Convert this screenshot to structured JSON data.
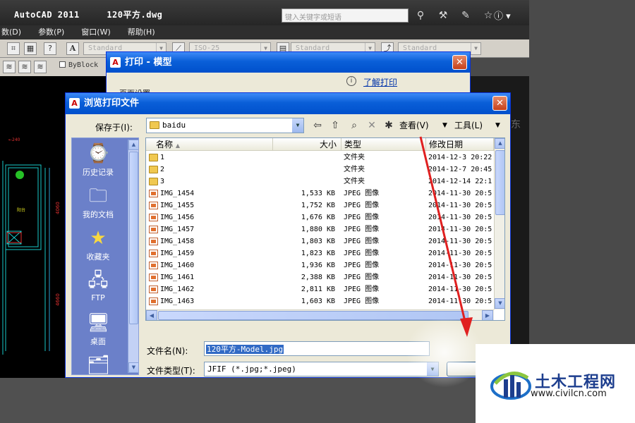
{
  "window": {
    "title": "AutoCAD 2011     120平方.dwg",
    "search_placeholder": "键入关键字或短语"
  },
  "menubar": {
    "items": [
      "数(D)",
      "参数(P)",
      "窗口(W)",
      "帮助(H)"
    ]
  },
  "toolbar": {
    "text_style": "Standard",
    "dim_style": "ISO-25",
    "table_style": "Standard",
    "mleader_style": "Standard",
    "linetype": "ByBlock"
  },
  "print_dialog": {
    "title": "打印 - 模型",
    "help_link": "了解打印",
    "page_setup_label": "页面设置"
  },
  "browse_dialog": {
    "title": "浏览打印文件",
    "save_in_label": "保存于(I):",
    "save_in_value": "baidu",
    "view_label": "查看(V)",
    "tools_label": "工具(L)",
    "places": [
      "历史记录",
      "我的文档",
      "收藏夹",
      "FTP",
      "桌面"
    ],
    "columns": {
      "name": "名称",
      "size": "大小",
      "type": "类型",
      "modified": "修改日期"
    },
    "files": [
      {
        "name": "1",
        "size": "",
        "type": "文件夹",
        "modified": "2014-12-3 20:22",
        "kind": "folder"
      },
      {
        "name": "2",
        "size": "",
        "type": "文件夹",
        "modified": "2014-12-7 20:45",
        "kind": "folder"
      },
      {
        "name": "3",
        "size": "",
        "type": "文件夹",
        "modified": "2014-12-14 22:1",
        "kind": "folder"
      },
      {
        "name": "IMG_1454",
        "size": "1,533 KB",
        "type": "JPEG 图像",
        "modified": "2014-11-30 20:5",
        "kind": "jpg"
      },
      {
        "name": "IMG_1455",
        "size": "1,752 KB",
        "type": "JPEG 图像",
        "modified": "2014-11-30 20:5",
        "kind": "jpg"
      },
      {
        "name": "IMG_1456",
        "size": "1,676 KB",
        "type": "JPEG 图像",
        "modified": "2014-11-30 20:5",
        "kind": "jpg"
      },
      {
        "name": "IMG_1457",
        "size": "1,880 KB",
        "type": "JPEG 图像",
        "modified": "2014-11-30 20:5",
        "kind": "jpg"
      },
      {
        "name": "IMG_1458",
        "size": "1,803 KB",
        "type": "JPEG 图像",
        "modified": "2014-11-30 20:5",
        "kind": "jpg"
      },
      {
        "name": "IMG_1459",
        "size": "1,823 KB",
        "type": "JPEG 图像",
        "modified": "2014-11-30 20:5",
        "kind": "jpg"
      },
      {
        "name": "IMG_1460",
        "size": "1,936 KB",
        "type": "JPEG 图像",
        "modified": "2014-11-30 20:5",
        "kind": "jpg"
      },
      {
        "name": "IMG_1461",
        "size": "2,388 KB",
        "type": "JPEG 图像",
        "modified": "2014-11-30 20:5",
        "kind": "jpg"
      },
      {
        "name": "IMG_1462",
        "size": "2,811 KB",
        "type": "JPEG 图像",
        "modified": "2014-11-30 20:5",
        "kind": "jpg"
      },
      {
        "name": "IMG_1463",
        "size": "1,603 KB",
        "type": "JPEG 图像",
        "modified": "2014-11-30 20:5",
        "kind": "jpg"
      }
    ],
    "file_name_label": "文件名(N):",
    "file_name_value": "120平方-Model.jpg",
    "file_type_label": "文件类型(T):",
    "file_type_value": "JFIF (*.jpg;*.jpeg)"
  },
  "background": {
    "east_char": "东",
    "drawing_labels": [
      "阳台",
      "4060",
      "4660"
    ]
  },
  "watermark": {
    "name": "土木工程网",
    "url": "www.civilcn.com"
  },
  "colors": {
    "xp_title": "#0a5fd8",
    "places_bar": "#6b80c9",
    "selection": "#316ac5",
    "annotation_arrow": "#e02020"
  }
}
